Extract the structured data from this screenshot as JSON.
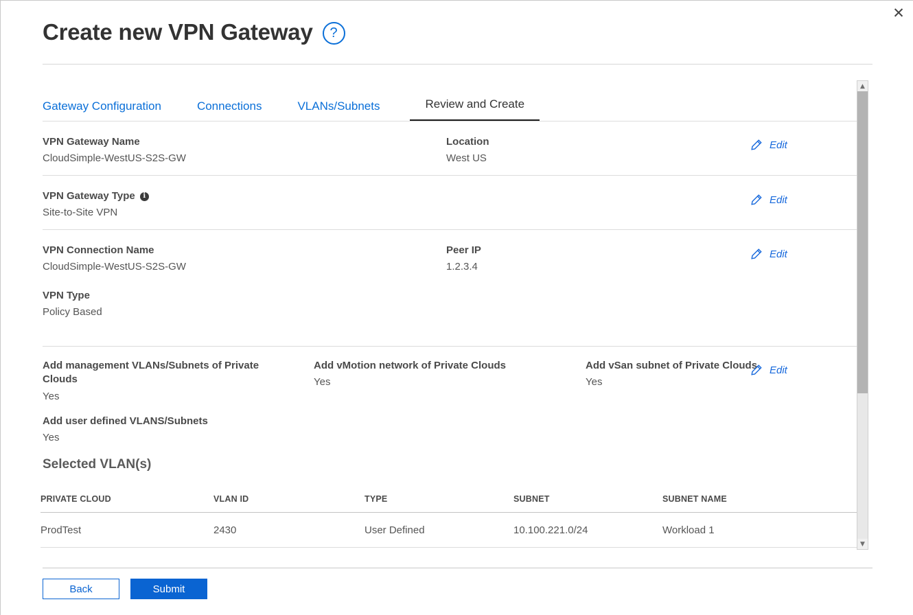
{
  "window": {
    "title": "Create new VPN Gateway",
    "help_icon": "question-mark-circle-icon",
    "close_icon": "close-icon"
  },
  "tabs": [
    {
      "label": "Gateway Configuration",
      "active": false
    },
    {
      "label": "Connections",
      "active": false
    },
    {
      "label": "VLANs/Subnets",
      "active": false
    },
    {
      "label": "Review and Create",
      "active": true
    }
  ],
  "edit_label": "Edit",
  "sections": {
    "gateway": {
      "name_label": "VPN Gateway Name",
      "name_value": "CloudSimple-WestUS-S2S-GW",
      "location_label": "Location",
      "location_value": "West US"
    },
    "gateway_type": {
      "label": "VPN Gateway Type",
      "value": "Site-to-Site VPN"
    },
    "connection": {
      "name_label": "VPN Connection Name",
      "name_value": "CloudSimple-WestUS-S2S-GW",
      "peer_ip_label": "Peer IP",
      "peer_ip_value": "1.2.3.4",
      "vpn_type_label": "VPN Type",
      "vpn_type_value": "Policy Based"
    },
    "vlans": {
      "mgmt_label": "Add management VLANs/Subnets of Private Clouds",
      "mgmt_value": "Yes",
      "vmotion_label": "Add vMotion network of Private Clouds",
      "vmotion_value": "Yes",
      "vsan_label": "Add vSan subnet of Private Clouds",
      "vsan_value": "Yes",
      "user_defined_label": "Add user defined VLANS/Subnets",
      "user_defined_value": "Yes"
    }
  },
  "vlan_table": {
    "heading": "Selected VLAN(s)",
    "columns": [
      "PRIVATE CLOUD",
      "VLAN ID",
      "TYPE",
      "SUBNET",
      "SUBNET NAME"
    ],
    "rows": [
      {
        "private_cloud": "ProdTest",
        "vlan_id": "2430",
        "type": "User Defined",
        "subnet": "10.100.221.0/24",
        "subnet_name": "Workload 1"
      }
    ]
  },
  "footer": {
    "back_label": "Back",
    "submit_label": "Submit"
  },
  "colors": {
    "accent": "#0a64d2",
    "link": "#0a6fd8",
    "text": "#333333",
    "muted": "#555555",
    "active_tab_underline": "#1b1b1b"
  }
}
